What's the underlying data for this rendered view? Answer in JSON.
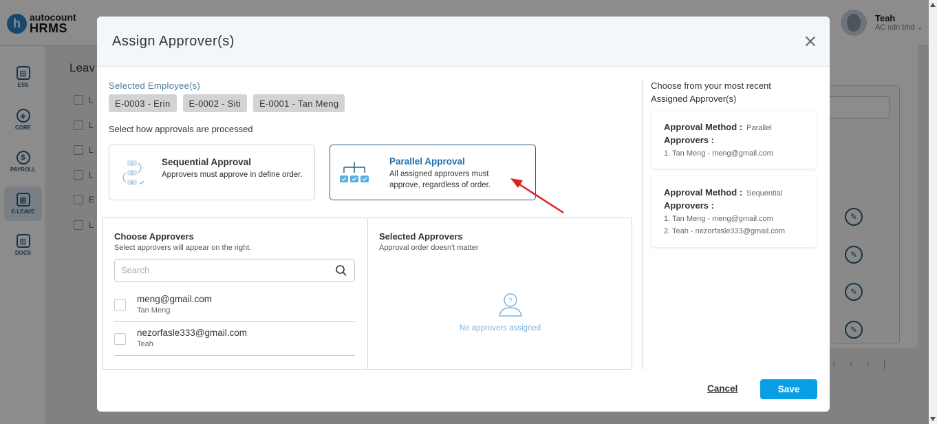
{
  "app": {
    "logo_top": "autocount",
    "logo_bottom": "HRMS",
    "user_name": "Teah",
    "user_company": "AC sdn bhd"
  },
  "sidebar": {
    "items": [
      {
        "label": "ESS",
        "icon": "id-card-icon"
      },
      {
        "label": "CORE",
        "icon": "cube-icon"
      },
      {
        "label": "PAYROLL",
        "icon": "dollar-icon"
      },
      {
        "label": "E-LEAVE",
        "icon": "calendar-icon",
        "active": true
      },
      {
        "label": "DOCS",
        "icon": "document-chart-icon"
      }
    ]
  },
  "background": {
    "heading": "Leav",
    "list_prefixes": [
      "L",
      "L",
      "L",
      "L",
      "E",
      "L"
    ]
  },
  "modal": {
    "title": "Assign Approver(s)",
    "selected_employees_label": "Selected Employee(s)",
    "employees": [
      "E-0003 - Erin",
      "E-0002 - Siti",
      "E-0001 - Tan Meng"
    ],
    "process_label": "Select how approvals are processed",
    "methods": {
      "sequential": {
        "title": "Sequential Approval",
        "description": "Approvers must approve in define order."
      },
      "parallel": {
        "title": "Parallel Approval",
        "description": "All assigned approvers must approve, regardless of order.",
        "selected": true
      }
    },
    "choose": {
      "title": "Choose Approvers",
      "subtitle": "Select approvers will appear on the right.",
      "search_placeholder": "Search",
      "approvers": [
        {
          "email": "meng@gmail.com",
          "name": "Tan Meng"
        },
        {
          "email": "nezorfasle333@gmail.com",
          "name": "Teah"
        }
      ]
    },
    "selected": {
      "title": "Selected Approvers",
      "subtitle": "Approval order doesn't matter",
      "empty_text": "No approvers assigned"
    },
    "recent": {
      "title": "Choose from your most recent Assigned Approver(s)",
      "method_label": "Approval Method :",
      "approvers_label": "Approvers :",
      "cards": [
        {
          "method": "Parallel",
          "approvers": [
            "1. Tan Meng - meng@gmail.com"
          ]
        },
        {
          "method": "Sequential",
          "approvers": [
            "1. Tan Meng - meng@gmail.com",
            "2. Teah - nezorfasle333@gmail.com"
          ]
        }
      ]
    },
    "cancel_label": "Cancel",
    "save_label": "Save"
  },
  "colors": {
    "accent": "#1f6ea8",
    "save": "#0a9fe4",
    "annotation_arrow": "#e02020"
  }
}
